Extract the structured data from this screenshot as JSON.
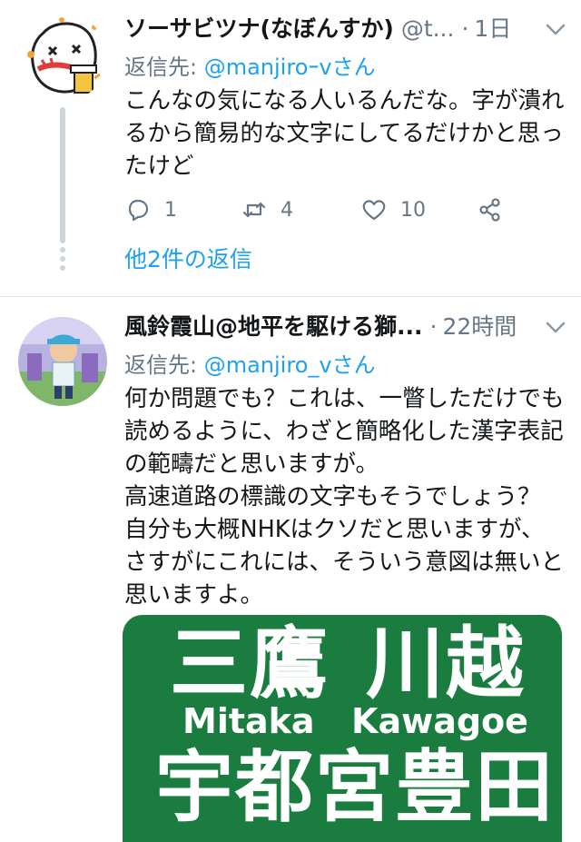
{
  "tweets": [
    {
      "author_name": "ソーサビツナ(なぼんすか)",
      "handle": "@t...",
      "time": "1日",
      "reply_prefix": "返信先: ",
      "reply_mention": "@manjiroｰvさん",
      "text": "こんなの気になる人いるんだな。字が潰れるから簡易的な文字にしてるだけかと思ったけど",
      "reply_count": "1",
      "retweet_count": "4",
      "like_count": "10",
      "more_replies": "他2件の返信"
    },
    {
      "author_name": "風鈴霞山@地平を駆ける獅...",
      "time": "22時間",
      "reply_prefix": "返信先: ",
      "reply_mention": "@manjiro_vさん",
      "text": "何か問題でも？これは、一瞥しただけでも読めるように、わざと簡略化した漢字表記の範疇だと思いますが。\n高速道路の標識の文字もそうでしょう？\n自分も大概NHKはクソだと思いますが、さすがにこれには、そういう意図は無いと思いますよ。",
      "sign": {
        "kanji_1": "三鷹",
        "kanji_2": "川越",
        "romaji_1": "Mitaka",
        "romaji_2": "Kawagoe",
        "kanji_3": "宇都宮",
        "kanji_4": "豊田",
        "color": "#1a7d3f"
      }
    }
  ],
  "colors": {
    "link": "#1da1f2",
    "secondary_text": "#657786",
    "divider": "#e1e8ed"
  },
  "icons": [
    "chevron-down-icon",
    "reply-icon",
    "retweet-icon",
    "like-icon",
    "share-icon"
  ]
}
